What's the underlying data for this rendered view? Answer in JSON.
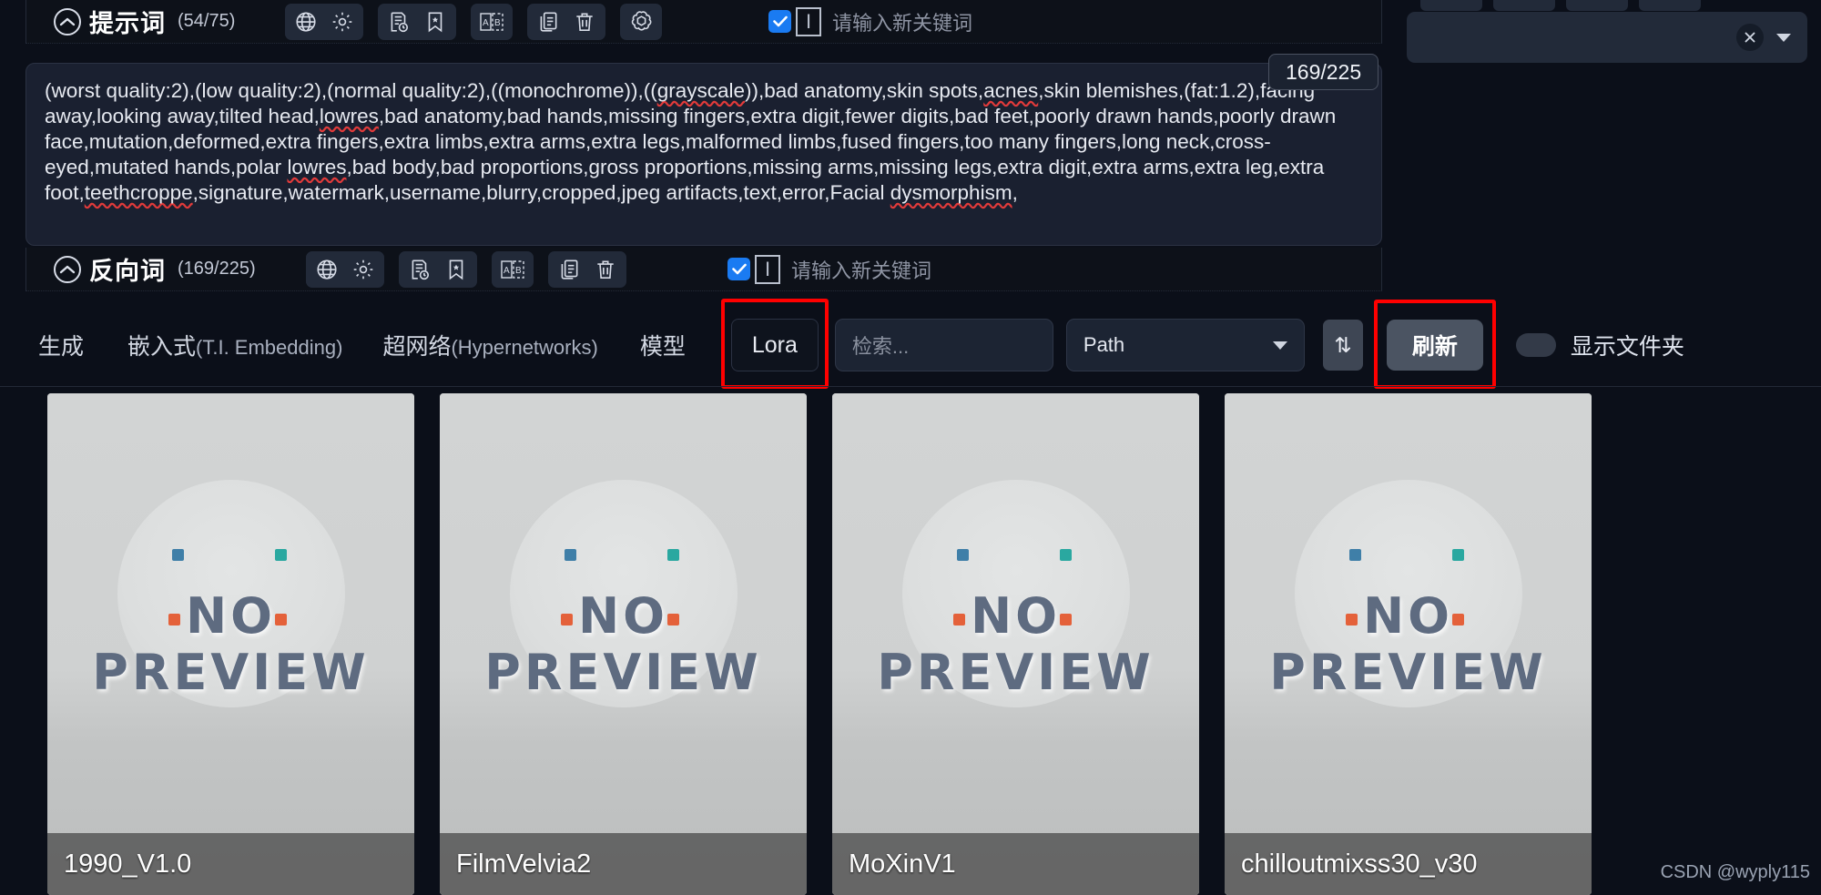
{
  "prompt_section": {
    "title": "提示词",
    "count": "(54/75)",
    "collapse_icon": "chevron-up-circle-icon",
    "toolbar": [
      {
        "name": "globe-icon",
        "glyph": "globe"
      },
      {
        "name": "gear-icon",
        "glyph": "gear"
      },
      {
        "name": "history-list-icon",
        "glyph": "history"
      },
      {
        "name": "bookmark-star-icon",
        "glyph": "bookmark"
      },
      {
        "name": "ab-translate-icon",
        "glyph": "ab"
      },
      {
        "name": "copy-icon",
        "glyph": "copy"
      },
      {
        "name": "trash-icon",
        "glyph": "trash"
      },
      {
        "name": "openai-icon",
        "glyph": "openai"
      }
    ],
    "keyword_checkbox_checked": true,
    "keyword_cursor_icon": "text-cursor-icon",
    "keyword_placeholder": "请输入新关键词"
  },
  "negative_section": {
    "title": "反向词",
    "count": "(169/225)",
    "collapse_icon": "chevron-up-circle-icon",
    "toolbar": [
      {
        "name": "globe-icon",
        "glyph": "globe"
      },
      {
        "name": "gear-icon",
        "glyph": "gear"
      },
      {
        "name": "history-list-icon",
        "glyph": "history"
      },
      {
        "name": "bookmark-star-icon",
        "glyph": "bookmark"
      },
      {
        "name": "ab-translate-icon",
        "glyph": "ab"
      },
      {
        "name": "copy-icon",
        "glyph": "copy"
      },
      {
        "name": "trash-icon",
        "glyph": "trash"
      }
    ],
    "keyword_checkbox_checked": true,
    "keyword_cursor_icon": "text-cursor-icon",
    "keyword_placeholder": "请输入新关键词"
  },
  "prompt_text_parts": {
    "p1": "(worst quality:2),(low quality:2),(normal quality:2),((monochrome)),((",
    "sp1": "grayscale",
    "p2": ")),bad anatomy,skin spots,",
    "sp2": "acnes",
    "p3": ",skin blemishes,(fat:1.2),facing away,looking away,tilted head,",
    "sp3": "lowres",
    "p4": ",bad anatomy,bad hands,missing fingers,extra digit,fewer digits,bad feet,poorly drawn hands,poorly drawn face,mutation,deformed,extra fingers,extra limbs,extra arms,extra legs,malformed limbs,fused fingers,too many fingers,long neck,cross-eyed,mutated hands,polar ",
    "sp4": "lowres",
    "p5": ",bad body,bad proportions,gross proportions,missing arms,missing legs,extra digit,extra arms,extra leg,extra foot,",
    "sp5": "teethcroppe",
    "p6": ",signature,watermark,username,blurry,cropped,jpeg artifacts,text,error,Facial ",
    "sp6": "dysmorphism",
    "p7": ","
  },
  "tooltip": {
    "text": "169/225"
  },
  "tabs": [
    {
      "label": "生成",
      "active": false
    },
    {
      "label": "嵌入式",
      "paren": "(T.I. Embedding)",
      "active": false
    },
    {
      "label": "超网络",
      "paren": "(Hypernetworks)",
      "active": false
    },
    {
      "label": "模型",
      "active": false
    },
    {
      "label": "Lora",
      "active": true,
      "highlighted": true
    }
  ],
  "toolbar": {
    "search_placeholder": "检索...",
    "search_value": "",
    "path_select_value": "Path",
    "path_select_icon": "chevron-down-icon",
    "sort_icon": "sort-updown-icon",
    "sort_label": "⇅",
    "refresh_label": "刷新",
    "refresh_highlighted": true,
    "show_folder_label": "显示文件夹",
    "show_folder_toggle_on": false
  },
  "top_right": {
    "clear_icon": "close-circle-icon",
    "dropdown_icon": "caret-down-icon",
    "field_value": ""
  },
  "cards": [
    {
      "name": "1990_V1.0",
      "preview_line1": "NO",
      "preview_line2": "PREVIEW"
    },
    {
      "name": "FilmVelvia2",
      "preview_line1": "NO",
      "preview_line2": "PREVIEW"
    },
    {
      "name": "MoXinV1",
      "preview_line1": "NO",
      "preview_line2": "PREVIEW"
    },
    {
      "name": "chilloutmixss30_v30",
      "preview_line1": "NO",
      "preview_line2": "PREVIEW"
    }
  ],
  "watermark": "CSDN @wyply115",
  "colors": {
    "background": "#0b0f19",
    "panel": "#1a2030",
    "accent_blue": "#1a7bf2",
    "highlight_red": "#ff0000",
    "button_gray": "#4b5462"
  }
}
